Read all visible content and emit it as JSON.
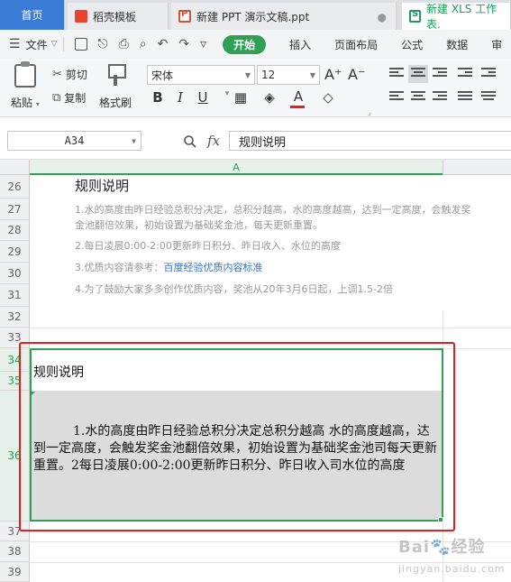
{
  "tabs": {
    "home": "首页",
    "docer": "稻壳模板",
    "ppt": "新建 PPT 演示文稿.ppt",
    "xls": "新建 XLS 工作表."
  },
  "menubar": {
    "file": "文件",
    "start": "开始",
    "items": [
      "插入",
      "页面布局",
      "公式",
      "数据",
      "审"
    ]
  },
  "ribbon": {
    "paste": "粘贴",
    "cut": "剪切",
    "copy": "复制",
    "format_painter": "格式刷",
    "font_name": "宋体",
    "font_size": "12",
    "bold": "B",
    "italic": "I",
    "underline": "U",
    "font_color_letter": "A",
    "grow_font": "A⁺",
    "shrink_font": "A⁻",
    "accent_color": "#2fa055",
    "font_color_bar": "#e02020"
  },
  "formula_bar": {
    "cell_ref": "A34",
    "fx": "fx",
    "content": "规则说明"
  },
  "grid": {
    "column": "A",
    "rows": [
      "26",
      "27",
      "28",
      "29",
      "30",
      "31",
      "32",
      "33",
      "34",
      "35",
      "36",
      "37",
      "38",
      "39"
    ]
  },
  "image_rules": {
    "title": "规则说明",
    "line1a": "1.水的高度由昨日经验总积分决定，总积分越高，水的高度越高，达到一定高度，会触发奖",
    "line1b": "金池翻倍效果，初始设置为基础奖金池，每天更新重置。",
    "line2": "2.每日凌晨0:00-2:00更新昨日积分、昨日收入、水位的高度",
    "line3_prefix": "3.优质内容请参考：",
    "line3_link": "百度经验优质内容标准",
    "line4": "4.为了鼓励大家多多创作优质内容，奖池从20年3月6日起，上调1.5-2倍"
  },
  "cells": {
    "a34": "规则说明",
    "a36": "1.水的高度由昨日经验总积分决定总积分越高 水的高度越高，达到一定高度，会触发奖金池翻倍效果，初始设置为基础奖金池司每天更新重置。2每日凌展0:00-2:00更新昨日积分、昨日收入司水位的高度"
  },
  "watermark": {
    "brand": "Bai",
    "brand2": "经验",
    "sub": "jingyan.baidu.com"
  }
}
